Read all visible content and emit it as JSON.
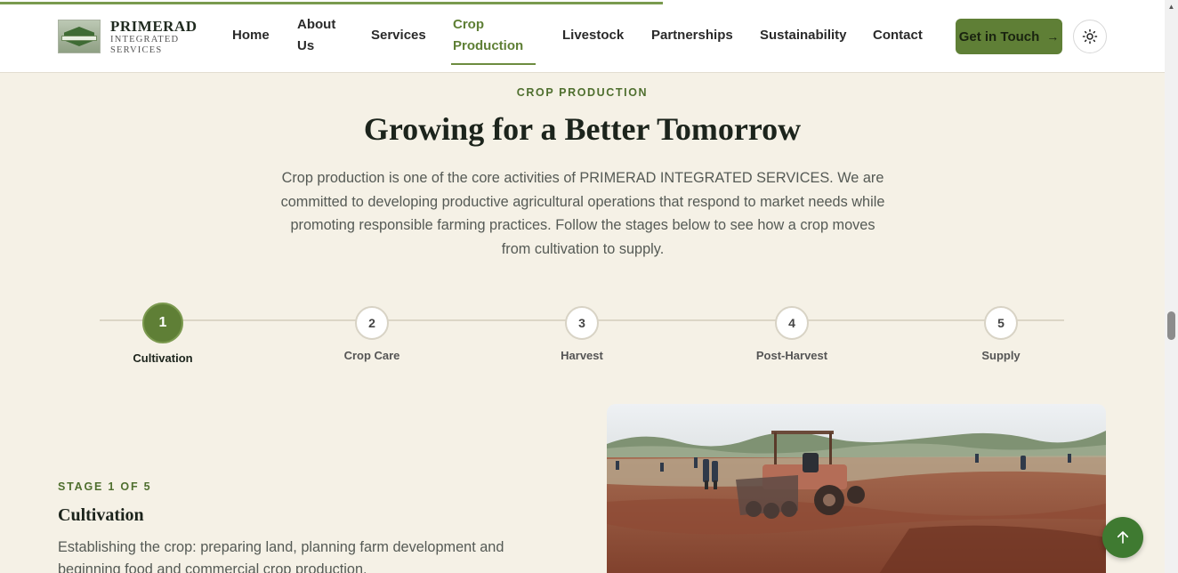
{
  "header": {
    "brand_name": "PRIMERAD",
    "brand_sub": "INTEGRATED SERVICES",
    "nav": [
      {
        "label": "Home"
      },
      {
        "label": "About Us"
      },
      {
        "label": "Services"
      },
      {
        "label": "Crop Production",
        "active": true
      },
      {
        "label": "Livestock"
      },
      {
        "label": "Partnerships"
      },
      {
        "label": "Sustainability"
      },
      {
        "label": "Contact"
      }
    ],
    "cta_label": "Get in Touch",
    "cta_arrow": "→",
    "accent_color": "#5f7f36"
  },
  "hero": {
    "eyebrow": "CROP PRODUCTION",
    "title": "Growing for a Better Tomorrow",
    "intro": "Crop production is one of the core activities of PRIMERAD INTEGRATED SERVICES. We are committed to developing productive agricultural operations that respond to market needs while promoting responsible farming practices. Follow the stages below to see how a crop moves from cultivation to supply."
  },
  "stepper": {
    "active_index": 0,
    "steps": [
      {
        "number": "1",
        "label": "Cultivation"
      },
      {
        "number": "2",
        "label": "Crop Care"
      },
      {
        "number": "3",
        "label": "Harvest"
      },
      {
        "number": "4",
        "label": "Post-Harvest"
      },
      {
        "number": "5",
        "label": "Supply"
      }
    ]
  },
  "stage": {
    "tag": "STAGE 1 OF 5",
    "title": "Cultivation",
    "description": "Establishing the crop: preparing land, planning farm development and beginning food and commercial crop production."
  },
  "icons": {
    "theme_toggle": "sun-icon",
    "back_to_top": "arrow-up-icon"
  }
}
